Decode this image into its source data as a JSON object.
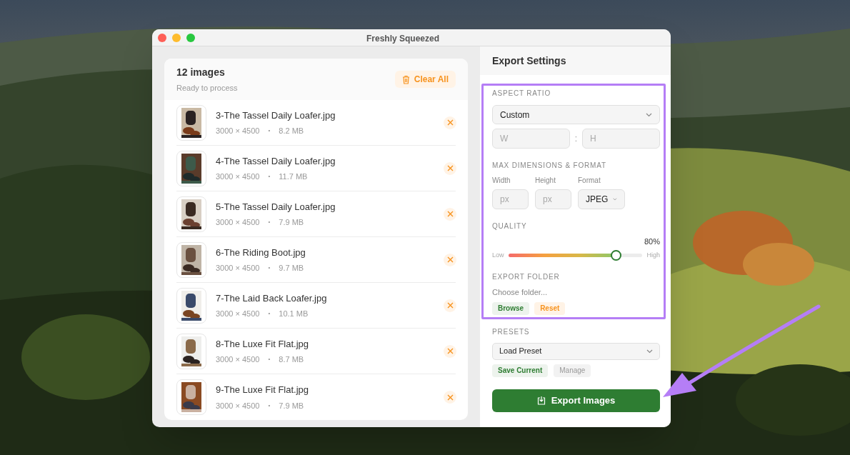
{
  "window": {
    "title": "Freshly Squeezed"
  },
  "image_list": {
    "count": "12 images",
    "status": "Ready to process",
    "clear_button": "Clear All",
    "files": [
      {
        "name": "3-The Tassel Daily Loafer.jpg",
        "dimensions": "3000 × 4500",
        "separator": "•",
        "size": "8.2 MB"
      },
      {
        "name": "4-The Tassel Daily Loafer.jpg",
        "dimensions": "3000 × 4500",
        "separator": "•",
        "size": "11.7 MB"
      },
      {
        "name": "5-The Tassel Daily Loafer.jpg",
        "dimensions": "3000 × 4500",
        "separator": "•",
        "size": "7.9 MB"
      },
      {
        "name": "6-The Riding Boot.jpg",
        "dimensions": "3000 × 4500",
        "separator": "•",
        "size": "9.7 MB"
      },
      {
        "name": "7-The Laid Back Loafer.jpg",
        "dimensions": "3000 × 4500",
        "separator": "•",
        "size": "10.1 MB"
      },
      {
        "name": "8-The Luxe Fit Flat.jpg",
        "dimensions": "3000 × 4500",
        "separator": "•",
        "size": "8.7 MB"
      },
      {
        "name": "9-The Luxe Fit Flat.jpg",
        "dimensions": "3000 × 4500",
        "separator": "•",
        "size": "7.9 MB"
      }
    ]
  },
  "export_settings": {
    "title": "Export Settings",
    "aspect_ratio": {
      "label": "ASPECT RATIO",
      "value": "Custom",
      "width_placeholder": "W",
      "separator": ":",
      "height_placeholder": "H"
    },
    "max_dimensions": {
      "label": "MAX DIMENSIONS & FORMAT",
      "width_label": "Width",
      "width_placeholder": "px",
      "height_label": "Height",
      "height_placeholder": "px",
      "format_label": "Format",
      "format": "JPEG"
    },
    "quality": {
      "label": "QUALITY",
      "reading": "80%",
      "low_label": "Low",
      "high_label": "High",
      "level": 0.8
    },
    "export_folder": {
      "label": "EXPORT FOLDER",
      "folder_text": "Choose folder...",
      "browse_button": "Browse",
      "reset_button": "Reset"
    },
    "presets": {
      "label": "PRESETS",
      "value": "Load Preset",
      "save_button": "Save Current",
      "manage_button": "Manage"
    },
    "export_button": "Export Images"
  }
}
